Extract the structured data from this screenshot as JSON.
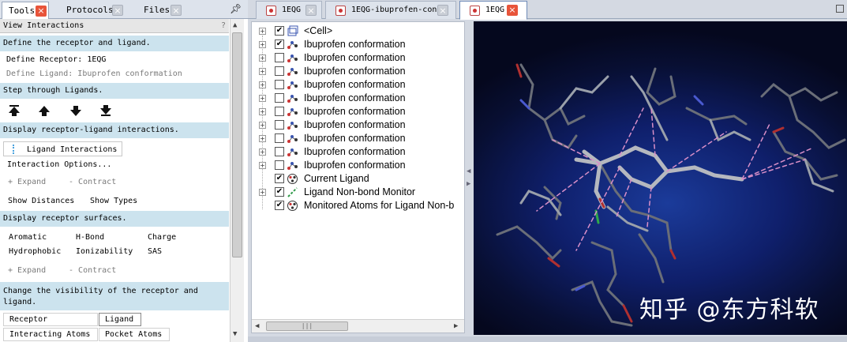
{
  "left_tabs": [
    {
      "label": "Tools",
      "active": true
    },
    {
      "label": "Protocols",
      "active": false
    },
    {
      "label": "Files",
      "active": false
    }
  ],
  "pin_icon": "pin-icon",
  "panel": {
    "title": "View Interactions",
    "help": "?",
    "sections": {
      "define": "Define the receptor and ligand.",
      "step": "Step through Ligands.",
      "display_interactions": "Display receptor-ligand interactions.",
      "surfaces": "Display receptor surfaces.",
      "visibility_1": "Change the visibility of the receptor and",
      "visibility_2": "ligand."
    },
    "define_receptor": "Define Receptor: 1EQG",
    "define_ligand": "Define Ligand: Ibuprofen conformation",
    "ligand_interactions": "Ligand Interactions",
    "interaction_options": "Interaction Options...",
    "expand": "Expand",
    "contract": "Contract",
    "show_distances": "Show Distances",
    "show_types": "Show Types",
    "surface_types": [
      "Aromatic",
      "H-Bond",
      "Charge",
      "Hydrophobic",
      "Ionizability",
      "SAS"
    ],
    "receptor": "Receptor",
    "ligand": "Ligand",
    "interacting_atoms": "Interacting Atoms",
    "pocket_atoms": "Pocket Atoms"
  },
  "doc_tabs": [
    {
      "label": "1EQG",
      "active": false
    },
    {
      "label": "1EQG-ibuprofen-conf",
      "active": false
    },
    {
      "label": "1EQG",
      "active": true
    }
  ],
  "tree": {
    "items": [
      {
        "label": "<Cell>",
        "checked": true,
        "expander": true,
        "icon": "cell-icon"
      },
      {
        "label": "Ibuprofen conformation",
        "checked": true,
        "expander": true,
        "icon": "molecule-icon"
      },
      {
        "label": "Ibuprofen conformation",
        "checked": false,
        "expander": true,
        "icon": "molecule-icon"
      },
      {
        "label": "Ibuprofen conformation",
        "checked": false,
        "expander": true,
        "icon": "molecule-icon"
      },
      {
        "label": "Ibuprofen conformation",
        "checked": false,
        "expander": true,
        "icon": "molecule-icon"
      },
      {
        "label": "Ibuprofen conformation",
        "checked": false,
        "expander": true,
        "icon": "molecule-icon"
      },
      {
        "label": "Ibuprofen conformation",
        "checked": false,
        "expander": true,
        "icon": "molecule-icon"
      },
      {
        "label": "Ibuprofen conformation",
        "checked": false,
        "expander": true,
        "icon": "molecule-icon"
      },
      {
        "label": "Ibuprofen conformation",
        "checked": false,
        "expander": true,
        "icon": "molecule-icon"
      },
      {
        "label": "Ibuprofen conformation",
        "checked": false,
        "expander": true,
        "icon": "molecule-icon"
      },
      {
        "label": "Ibuprofen conformation",
        "checked": false,
        "expander": true,
        "icon": "molecule-icon"
      },
      {
        "label": "Current Ligand",
        "checked": true,
        "expander": false,
        "icon": "atom-group-icon"
      },
      {
        "label": "Ligand Non-bond Monitor",
        "checked": true,
        "expander": true,
        "icon": "monitor-icon"
      },
      {
        "label": "Monitored Atoms for Ligand Non-b",
        "checked": true,
        "expander": false,
        "icon": "atom-group-icon"
      }
    ]
  },
  "viewer": {
    "watermark": "知乎 @东方科软"
  },
  "colors": {
    "section_bg": "#cce3ee",
    "close_red": "#e8543a",
    "viewer_bg": "#0f1f6b"
  }
}
